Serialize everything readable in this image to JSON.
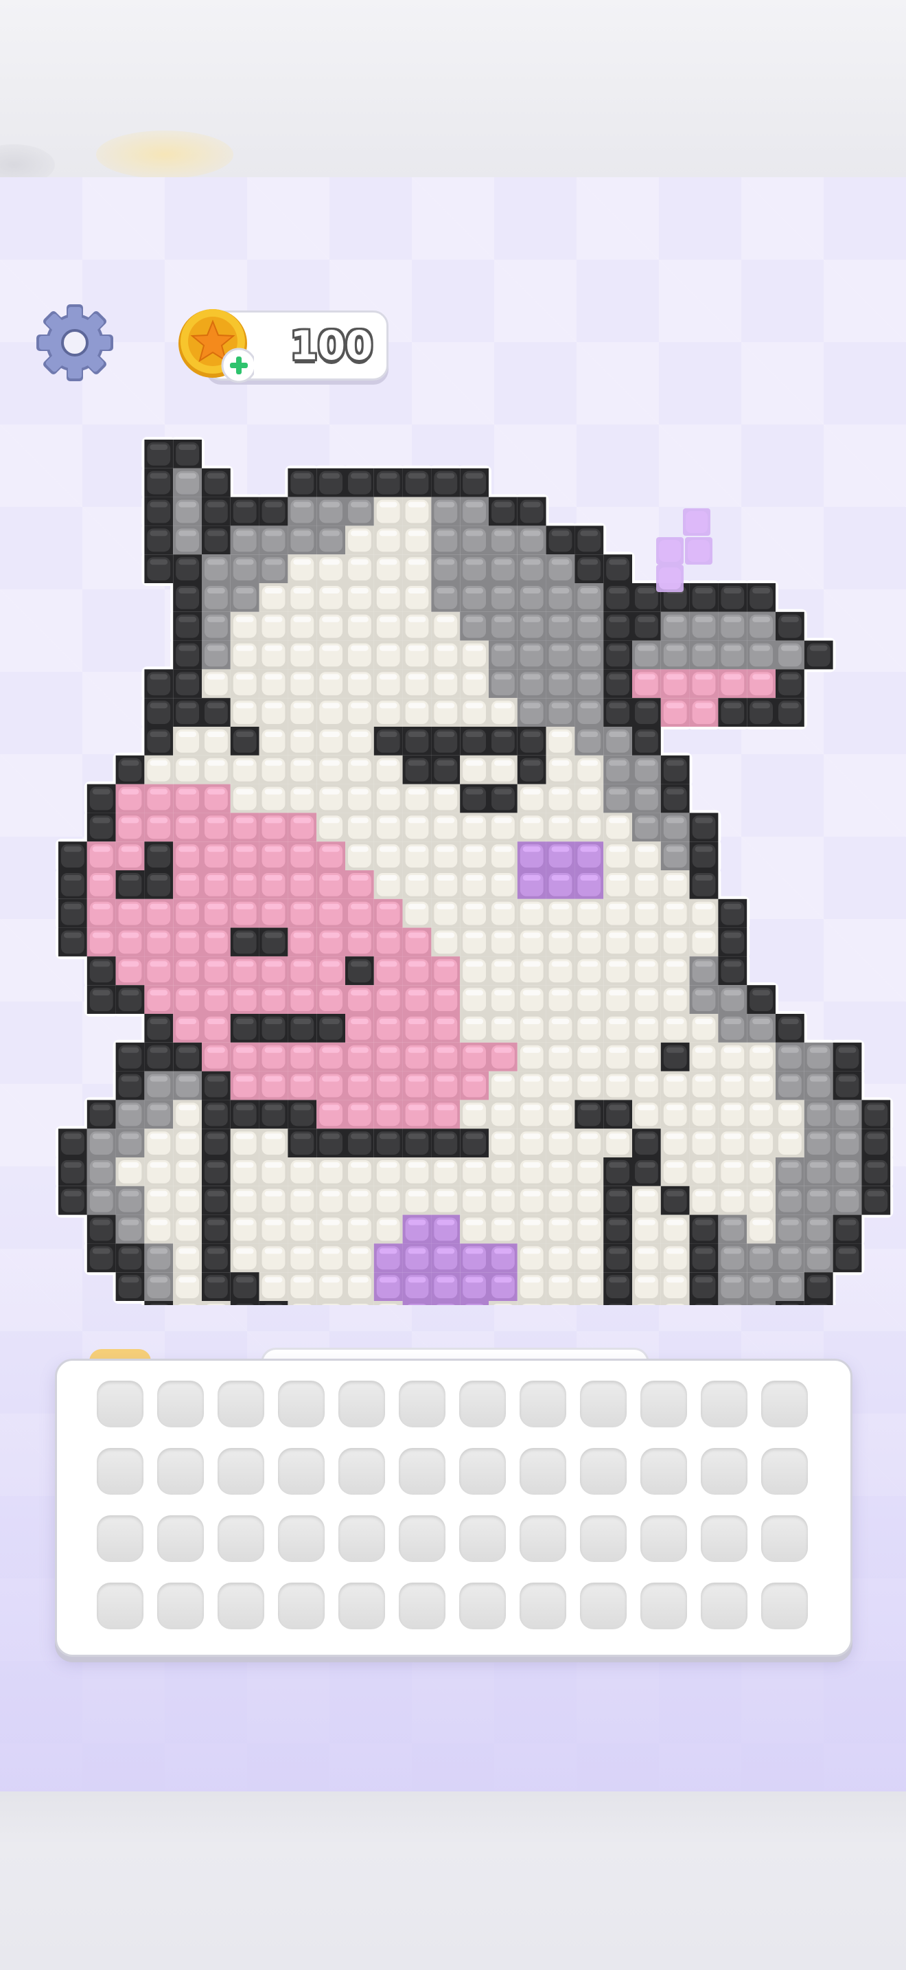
{
  "hud": {
    "coins": "100",
    "settings_icon": "gear-icon",
    "coin_icon": "star-coin-icon",
    "add_icon": "plus-icon"
  },
  "puzzle": {
    "subject": "cow",
    "colors": {
      "black": "#3c3c3e",
      "gray": "#9d9da0",
      "cream": "#f2efe6",
      "pink": "#f1a8c3",
      "purple": "#c597e4"
    }
  },
  "tray": {
    "rows": 4,
    "cols": 12,
    "slot_state": "empty"
  },
  "colors": {
    "background": "#ebe8fb",
    "coin_gold": "#f5b51e",
    "plus_green": "#2ec36d",
    "gear": "#7d88bd"
  }
}
